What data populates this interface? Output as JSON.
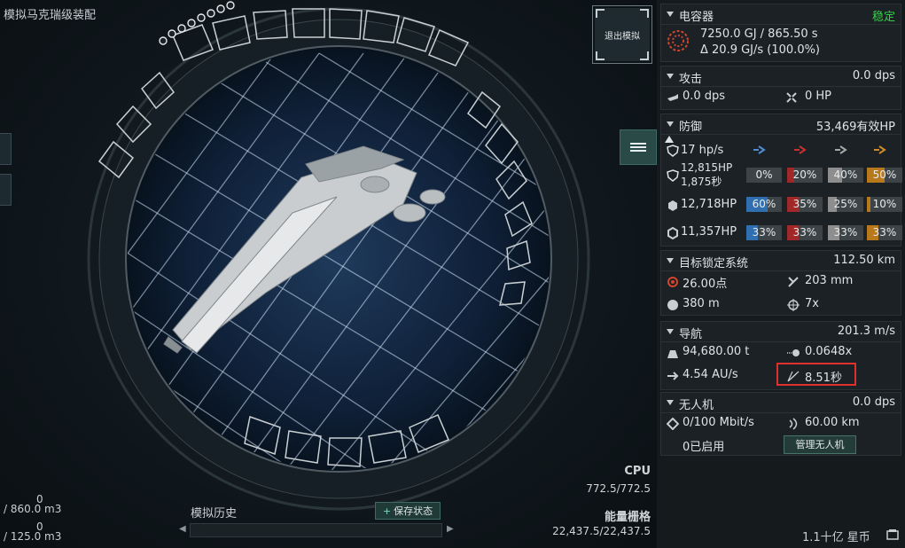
{
  "window": {
    "title": "模拟马克瑞级装配",
    "exit_button": "退出模拟"
  },
  "left_stats": {
    "cpu_label": "CPU",
    "cpu_value": "772.5/772.5",
    "pg_label": "能量栅格",
    "pg_value": "22,437.5/22,437.5"
  },
  "resources": [
    {
      "used": "0",
      "total": "/ 860.0 m3"
    },
    {
      "used": "0",
      "total": "/ 125.0 m3"
    }
  ],
  "history": {
    "label": "模拟历史",
    "save_button": "保存状态"
  },
  "wallet": {
    "amount": "1.1十亿 星币"
  },
  "capacitor": {
    "title": "电容器",
    "status": "稳定",
    "status_color": "#37d14b",
    "line1": "7250.0 GJ / 865.50 s",
    "line2": "Δ 20.9 GJ/s (100.0%)"
  },
  "offense": {
    "title": "攻击",
    "value": "0.0 dps",
    "turret_dps": "0.0 dps",
    "repair": "0 HP"
  },
  "defense": {
    "title": "防御",
    "value": "53,469有效HP",
    "regen": "17 hp/s",
    "shield": {
      "hp": "12,815HP",
      "time": "1,875秒",
      "resists": [
        "0%",
        "20%",
        "40%",
        "50%"
      ],
      "fills": [
        0,
        0.2,
        0.4,
        0.5
      ]
    },
    "armor": {
      "hp": "12,718HP",
      "resists": [
        "60%",
        "35%",
        "25%",
        "10%"
      ],
      "fills": [
        0.6,
        0.35,
        0.25,
        0.1
      ]
    },
    "hull": {
      "hp": "11,357HP",
      "resists": [
        "33%",
        "33%",
        "33%",
        "33%"
      ],
      "fills": [
        0.33,
        0.33,
        0.33,
        0.33
      ]
    },
    "colors": [
      "#2f6fb0",
      "#a02828",
      "#8e8e8e",
      "#b8781c"
    ]
  },
  "targeting": {
    "title": "目标锁定系统",
    "value": "112.50 km",
    "sensor": "26.00点",
    "scan_res": "203 mm",
    "sig_radius": "380 m",
    "max_targets": "7x"
  },
  "navigation": {
    "title": "导航",
    "value": "201.3 m/s",
    "mass": "94,680.00 t",
    "agility": "0.0648x",
    "warp": "4.54 AU/s",
    "align": "8.51秒"
  },
  "drones": {
    "title": "无人机",
    "value": "0.0 dps",
    "bandwidth": "0/100 Mbit/s",
    "range": "60.00 km",
    "active": "0已启用",
    "manage_button": "管理无人机"
  }
}
